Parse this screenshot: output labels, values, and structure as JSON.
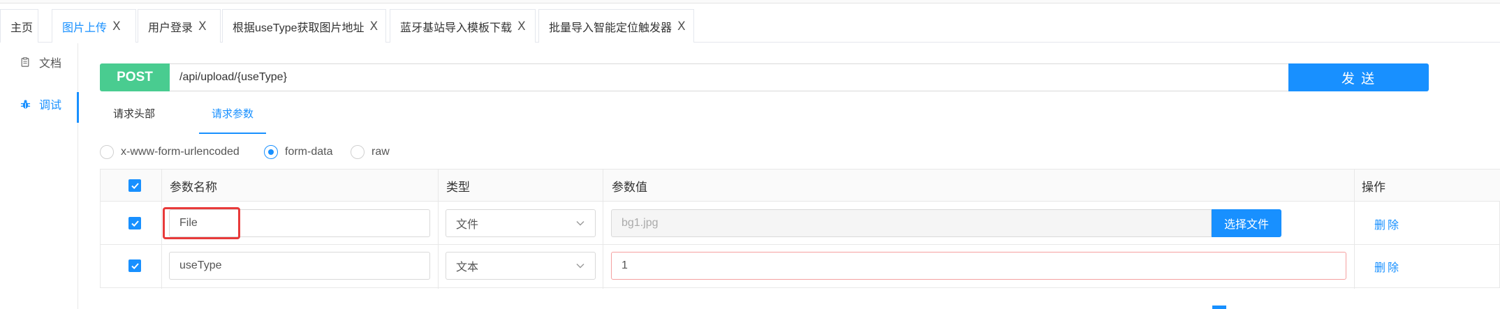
{
  "tabs": [
    {
      "label": "主页",
      "closable": false,
      "active": false
    },
    {
      "label": "图片上传",
      "closable": true,
      "active": true
    },
    {
      "label": "用户登录",
      "closable": true,
      "active": false
    },
    {
      "label": "根据useType获取图片地址",
      "closable": true,
      "active": false
    },
    {
      "label": "蓝牙基站导入模板下载",
      "closable": true,
      "active": false
    },
    {
      "label": "批量导入智能定位触发器",
      "closable": true,
      "active": false
    }
  ],
  "tab_close_glyph": "X",
  "sidebar": {
    "items": [
      {
        "label": "文档",
        "icon": "document-icon",
        "active": false
      },
      {
        "label": "调试",
        "icon": "bug-icon",
        "active": true
      }
    ]
  },
  "request": {
    "method": "POST",
    "url": "/api/upload/{useType}",
    "send_label": "发 送"
  },
  "request_tabs": [
    {
      "label": "请求头部",
      "active": false
    },
    {
      "label": "请求参数",
      "active": true
    }
  ],
  "body_types": [
    {
      "label": "x-www-form-urlencoded",
      "selected": false
    },
    {
      "label": "form-data",
      "selected": true
    },
    {
      "label": "raw",
      "selected": false
    }
  ],
  "params_table": {
    "headers": {
      "name": "参数名称",
      "type": "类型",
      "value": "参数值",
      "action": "操作"
    },
    "rows": [
      {
        "checked": true,
        "name": "File",
        "type": "文件",
        "value": "bg1.jpg",
        "file_button": "选择文件",
        "action": "删除"
      },
      {
        "checked": true,
        "name": "useType",
        "type": "文本",
        "value": "1",
        "action": "删除"
      }
    ]
  },
  "colors": {
    "accent": "#1890ff",
    "post": "#49cc90",
    "highlight": "#e83a3a"
  }
}
